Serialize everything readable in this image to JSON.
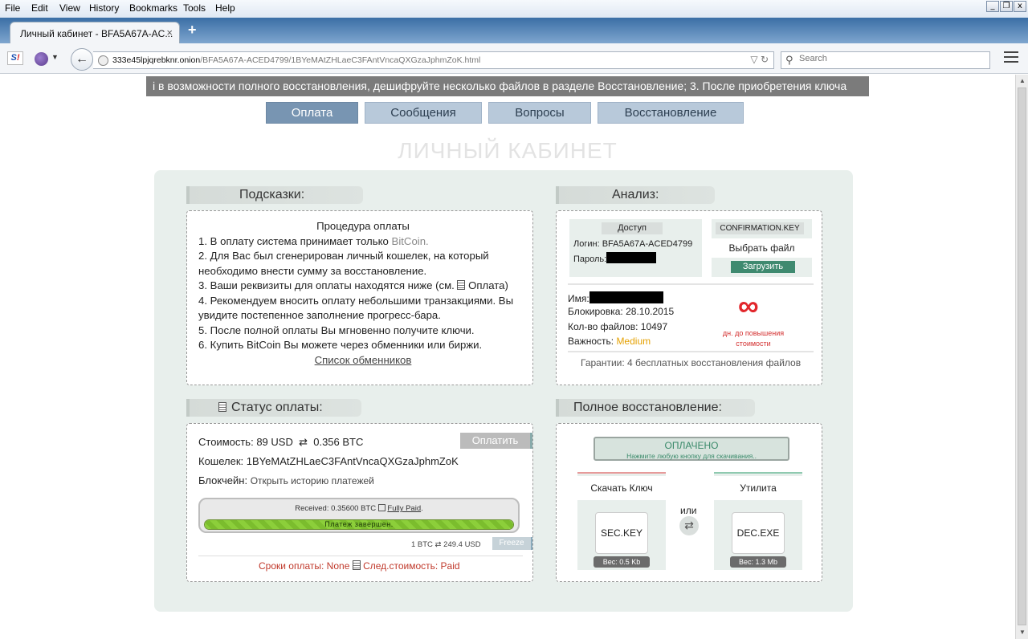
{
  "menu": [
    "File",
    "Edit",
    "View",
    "History",
    "Bookmarks",
    "Tools",
    "Help"
  ],
  "window_buttons": {
    "minimize": "_",
    "restore": "❐",
    "close": "x"
  },
  "tab": {
    "title": "Личный кабинет - BFA5A67A-AC...",
    "close": "×",
    "new_tab": "+"
  },
  "nav": {
    "url_host": "333e45lpjqrebknr.onion",
    "url_path": "/BFA5A67A-ACED4799/1BYeMAtZHLaeC3FAntVncaQXGzaJphmZoK.html",
    "search_placeholder": "Search"
  },
  "ticker_text": "і в возможности полного восстановления, дешифруйте несколько файлов в разделе Восстановление; 3. После приобретения ключа",
  "tabs": [
    "Оплата",
    "Сообщения",
    "Вопросы",
    "Восстановление"
  ],
  "page_title": "ЛИЧНЫЙ КАБИНЕТ",
  "tips": {
    "heading": "Подсказки:",
    "title": "Процедура оплаты",
    "l1a": "1. В оплату система принимает только ",
    "l1b": "BitCoin.",
    "l2": "2. Для Вас был сгенерирован личный кошелек, на который необходимо внести сумму за восстановление.",
    "l3a": "3. Ваши реквизиты для оплаты находятся ниже (см. ",
    "l3b": " Оплата)",
    "l4": "4. Рекомендуем вносить оплату небольшими транзакциями. Вы увидите постепенное заполнение прогресс-бара.",
    "l5": "5. После полной оплаты Вы мгновенно получите ключи.",
    "l6": "6. Купить BitCoin Вы можете через обменники или биржи.",
    "link": "Список обменников"
  },
  "analysis": {
    "heading": "Анализ:",
    "access_label": "Доступ",
    "login_label": "Логин:",
    "login_value": "BFA5A67A-ACED4799",
    "password_label": "Пароль:",
    "key_label": "CONFIRMATION.KEY",
    "choose_file": "Выбрать файл",
    "upload": "Загрузить",
    "name_label": "Имя:",
    "block_label": "Блокировка:",
    "block_value": "28.10.2015",
    "files_label": "Кол-во файлов:",
    "files_value": "10497",
    "importance_label": "Важность:",
    "importance_value": "Medium",
    "infinity": "∞",
    "days_note": "дн. до повышения стоимости",
    "guarantee": "Гарантии: 4 бесплатных восстановления файлов"
  },
  "payment": {
    "heading": "Статус оплаты:",
    "cost_label": "Стоимость:",
    "cost_usd": "89 USD",
    "cost_arrow": "⇄",
    "cost_btc": "0.356 BTC",
    "pay_button": "Оплатить",
    "wallet_label": "Кошелек:",
    "wallet_value": "1BYeMAtZHLaeC3FAntVncaQXGzaJphmZoK",
    "chain_label": "Блокчейн:",
    "chain_link": "Открыть историю платежей",
    "received_label": "Received: 0.35600 BTC",
    "fully_paid": "Fully Paid",
    "progress_label": "Платеж завершен.",
    "progress_fraction": 1.0,
    "rate": "1 BTC ⇄ 249.4 USD",
    "freeze": "Freeze",
    "terms": "Сроки оплаты: None",
    "next_cost": "След.стоимость: Paid"
  },
  "recovery": {
    "heading": "Полное восстановление:",
    "paid": "ОПЛАЧЕНО",
    "paid_hint": "Нажмите любую кнопку для скачивания..",
    "key_title": "Скачать Ключ",
    "key_file": "SEC.KEY",
    "key_size": "Вес: 0.5 Kb",
    "or": "или",
    "util_title": "Утилита",
    "util_file": "DEC.EXE",
    "util_size": "Вес: 1.3 Mb"
  },
  "colors": {
    "accent_green": "#3f8a70",
    "importance": "#e5a100",
    "infinity": "#e2272c",
    "tab_active": "#7895b2"
  }
}
